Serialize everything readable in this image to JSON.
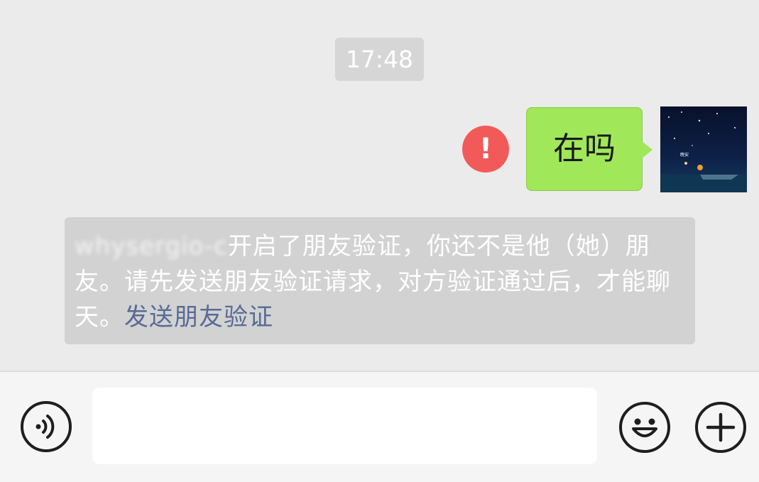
{
  "chat": {
    "timestamp": "17:48",
    "message": {
      "text": "在吗",
      "status": "failed",
      "status_icon": "exclamation-icon"
    },
    "system_notice": {
      "name": "whysergio-c",
      "text_after_name": "开启了朋友验证，你还不是他（她）朋友。请先发送朋友验证请求，对方验证通过后，才能聊天。",
      "link_text": "发送朋友验证"
    }
  },
  "input_bar": {
    "voice_icon": "voice-icon",
    "input_value": "",
    "emoji_icon": "emoji-icon",
    "plus_icon": "plus-icon"
  },
  "colors": {
    "background": "#ebebeb",
    "sent_bubble": "#a0e75a",
    "error_badge": "#f25a5a",
    "link": "#576b95"
  }
}
